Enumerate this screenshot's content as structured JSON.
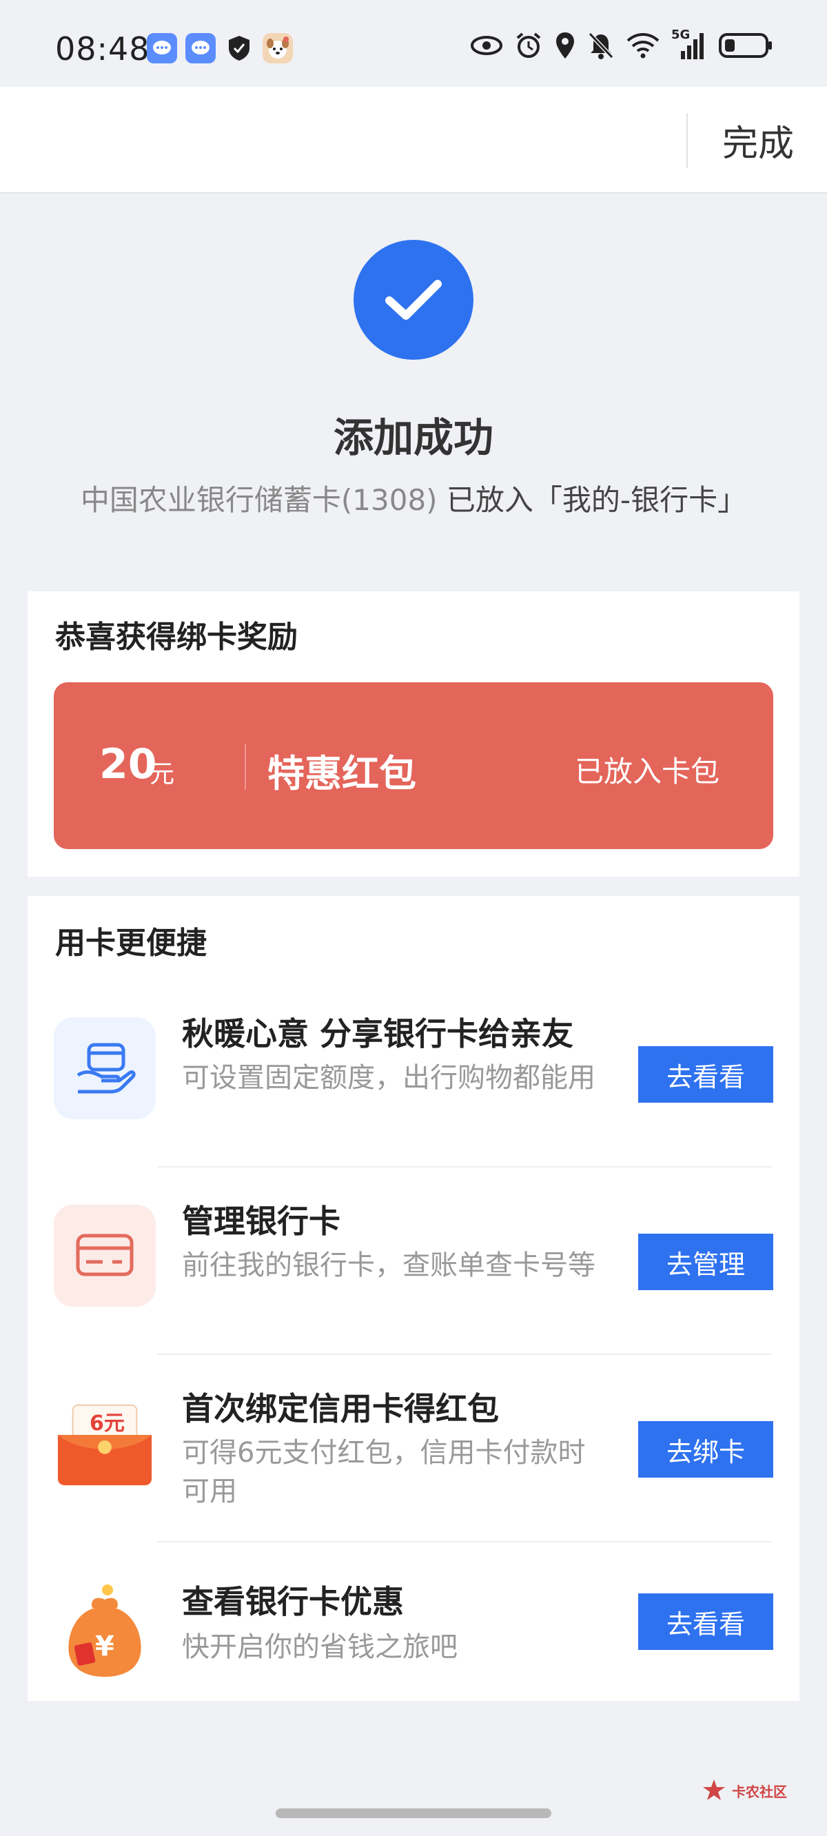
{
  "status_bar": {
    "time": "08:48",
    "network": "5G",
    "left_icons": [
      "message-app-icon",
      "message-app-icon",
      "shield-app-icon",
      "dog-app-icon"
    ],
    "right_icons": [
      "eye-icon",
      "alarm-icon",
      "location-icon",
      "mute-bell-icon",
      "wifi-icon",
      "signal-icon",
      "battery-icon"
    ]
  },
  "header": {
    "done_label": "完成"
  },
  "success": {
    "title": "添加成功",
    "desc_light": "中国农业银行储蓄卡(1308) ",
    "desc_dark": "已放入「我的-银行卡」"
  },
  "reward": {
    "title": "恭喜获得绑卡奖励",
    "amount": "20",
    "unit": "元",
    "name": "特惠红包",
    "status": "已放入卡包"
  },
  "use_section": {
    "title": "用卡更便捷",
    "items": [
      {
        "icon": "card-share-hand-icon",
        "title": "秋暖心意 分享银行卡给亲友",
        "desc": "可设置固定额度，出行购物都能用",
        "button": "去看看"
      },
      {
        "icon": "bank-card-icon",
        "title": "管理银行卡",
        "desc": "前往我的银行卡，查账单查卡号等",
        "button": "去管理"
      },
      {
        "icon": "red-envelope-icon",
        "icon_text": "6元",
        "title": "首次绑定信用卡得红包",
        "desc": "可得6元支付红包，信用卡付款时可用",
        "button": "去绑卡"
      },
      {
        "icon": "money-bag-icon",
        "icon_text": "¥",
        "title": "查看银行卡优惠",
        "desc": "快开启你的省钱之旅吧",
        "button": "去看看"
      }
    ]
  },
  "watermark": {
    "text": "卡农社区"
  },
  "colors": {
    "accent_blue": "#2e72f0",
    "reward_red": "#e4655a",
    "background": "#f0f1f5"
  }
}
